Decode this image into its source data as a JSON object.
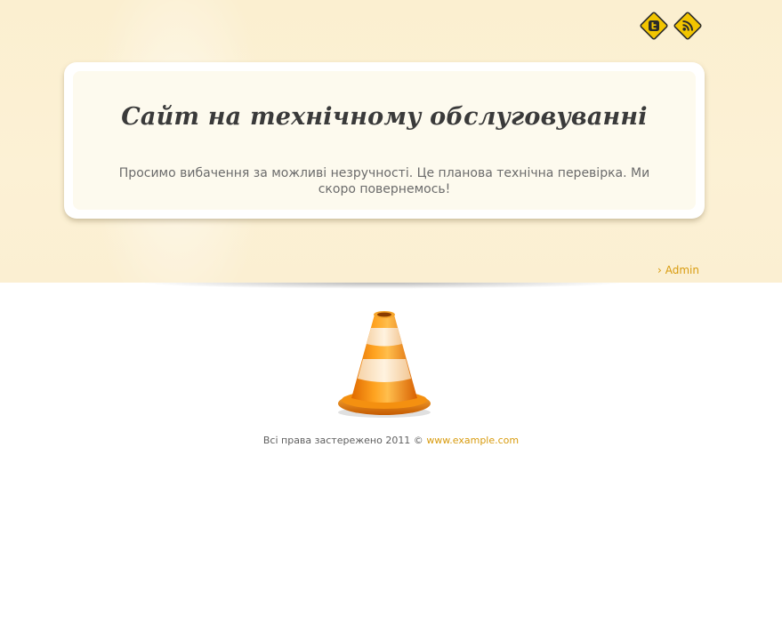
{
  "social": {
    "twitter_icon": "twitter-sign-icon",
    "rss_icon": "rss-sign-icon"
  },
  "card": {
    "title": "Сайт на технічному обслуговуванні",
    "message": "Просимо вибачення за можливі незручності. Це планова технічна перевірка. Ми скоро повернемось!"
  },
  "admin": {
    "arrow": "›",
    "label": "Admin"
  },
  "footer": {
    "text": "Всі права застережено 2011 ©",
    "link_text": "www.example.com"
  },
  "colors": {
    "accent": "#d89b0e",
    "band": "#fcf1d5",
    "title": "#3a3a3a",
    "cone_orange": "#f08a00"
  }
}
